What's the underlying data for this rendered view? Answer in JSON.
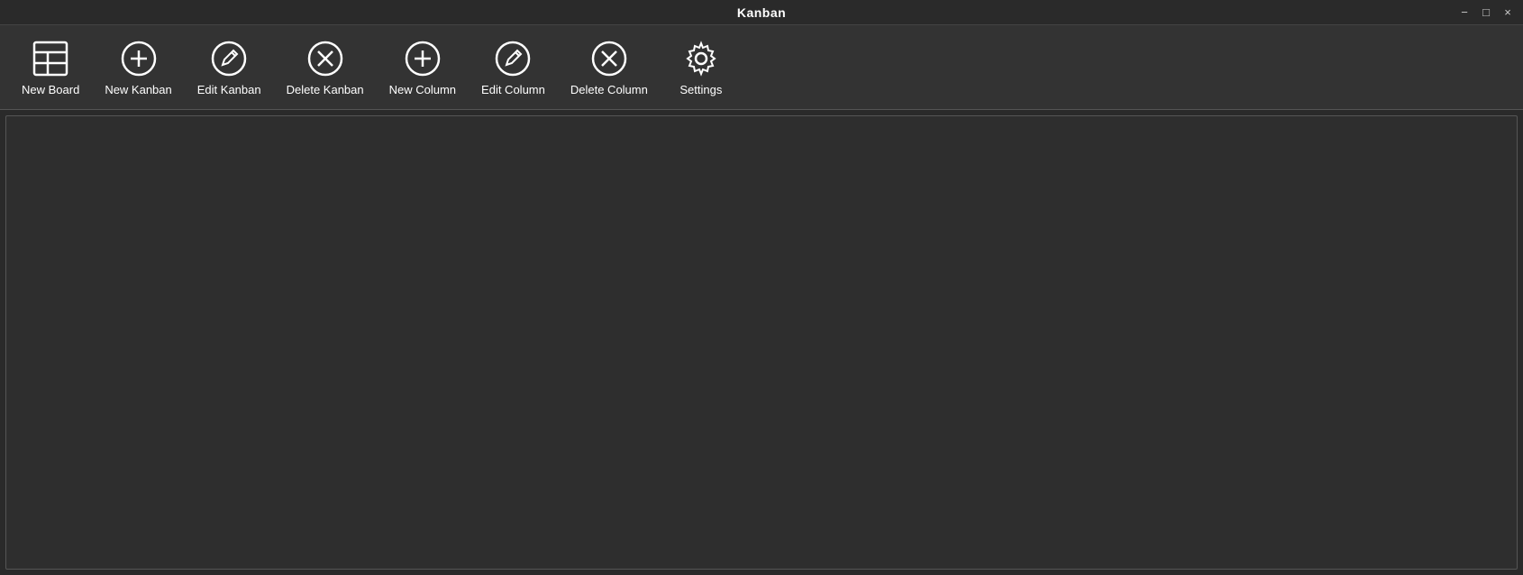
{
  "titleBar": {
    "title": "Kanban",
    "controls": {
      "minimize": "−",
      "maximize": "□",
      "close": "×"
    }
  },
  "toolbar": {
    "items": [
      {
        "name": "new-board",
        "label": "New Board",
        "icon": "table-icon"
      },
      {
        "name": "new-kanban",
        "label": "New Kanban",
        "icon": "plus-circle-icon"
      },
      {
        "name": "edit-kanban",
        "label": "Edit Kanban",
        "icon": "edit-circle-icon"
      },
      {
        "name": "delete-kanban",
        "label": "Delete Kanban",
        "icon": "x-circle-icon"
      },
      {
        "name": "new-column",
        "label": "New Column",
        "icon": "plus-circle-icon"
      },
      {
        "name": "edit-column",
        "label": "Edit Column",
        "icon": "edit-circle-icon"
      },
      {
        "name": "delete-column",
        "label": "Delete Column",
        "icon": "x-circle-icon"
      },
      {
        "name": "settings",
        "label": "Settings",
        "icon": "gear-icon"
      }
    ]
  }
}
